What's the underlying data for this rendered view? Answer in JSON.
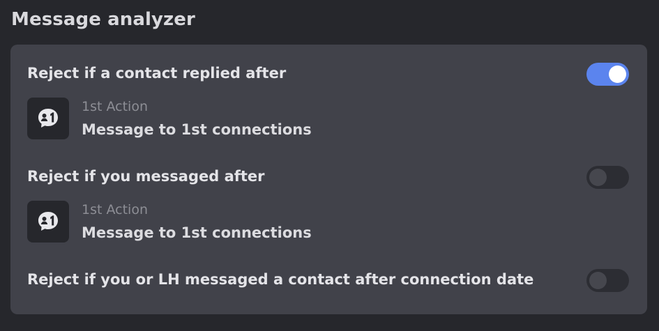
{
  "page": {
    "title": "Message analyzer"
  },
  "rules": [
    {
      "label": "Reject if a contact replied after",
      "enabled": true,
      "action": {
        "step": "1st Action",
        "name": "Message to 1st connections",
        "icon": "message-1st-icon"
      }
    },
    {
      "label": "Reject if you messaged after",
      "enabled": false,
      "action": {
        "step": "1st Action",
        "name": "Message to 1st connections",
        "icon": "message-1st-icon"
      }
    },
    {
      "label": "Reject if you or LH messaged a contact after connection date",
      "enabled": false
    }
  ],
  "colors": {
    "background": "#26272c",
    "panel": "#41424a",
    "toggle_on": "#5b84ee",
    "toggle_off": "#2c2d33"
  }
}
